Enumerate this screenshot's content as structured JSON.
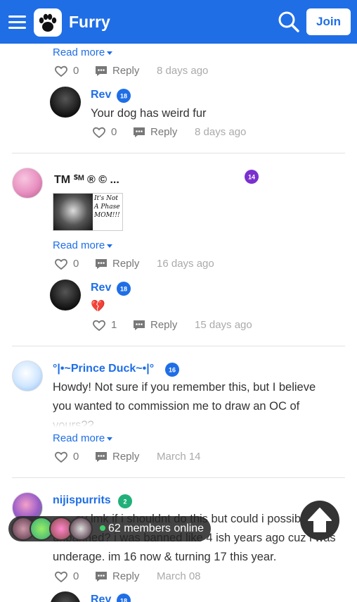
{
  "header": {
    "title": "Furry",
    "join_label": "Join"
  },
  "read_more_label": "Read more",
  "reply_label": "Reply",
  "comments": [
    {
      "likes": "0",
      "time": "8 days ago",
      "reply": {
        "user": "Rev",
        "level": "18",
        "text": "Your dog has weird fur",
        "likes": "0",
        "time": "8 days ago"
      }
    },
    {
      "user": "TM ᔆᴹ ® © ...",
      "level": "14",
      "image_text": "It's Not A Phase MOM!!!",
      "likes": "0",
      "time": "16 days ago",
      "reply": {
        "user": "Rev",
        "level": "18",
        "text": "💔",
        "likes": "1",
        "time": "15 days ago"
      }
    },
    {
      "user": "°|•~Prince Duck~•|°",
      "level": "16",
      "text": "Howdy! Not sure if you remember this, but I believe you wanted to commission me to draw an OC of yours??",
      "likes": "0",
      "time": "March 14"
    },
    {
      "user": "nijispurrits",
      "level": "2",
      "text": "ey lmk if i shouldnt do this but could i possibly get unbanned? i was banned like 4 ish years ago cuz i was underage. im 16 now & turning 17 this year.",
      "likes": "0",
      "time": "March 08",
      "reply": {
        "user": "Rev",
        "level": "18"
      }
    }
  ],
  "online": {
    "text": "62 members online"
  },
  "colors": {
    "brand": "#1f6ee6",
    "level_badge": "#1f6ee6",
    "level_badge_purple": "#7b2fcf",
    "level_badge_green": "#21b07a",
    "online_dot": "#3fd06b"
  }
}
